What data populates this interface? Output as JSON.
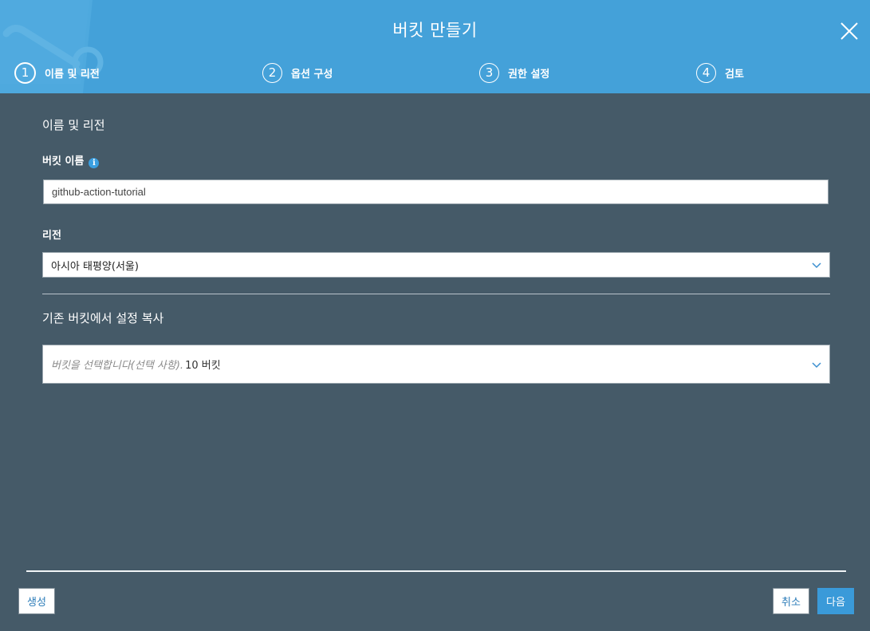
{
  "dialog": {
    "title": "버킷 만들기",
    "close_icon": "close-icon"
  },
  "steps": [
    {
      "number": "1",
      "label": "이름 및 리전",
      "active": true
    },
    {
      "number": "2",
      "label": "옵션 구성",
      "active": false
    },
    {
      "number": "3",
      "label": "권한 설정",
      "active": false
    },
    {
      "number": "4",
      "label": "검토",
      "active": false
    }
  ],
  "name_region": {
    "section_title": "이름 및 리전",
    "bucket_name_label": "버킷 이름",
    "bucket_name_value": "github-action-tutorial",
    "region_label": "리전",
    "region_value": "아시아 태평양(서울)"
  },
  "copy_settings": {
    "section_title": "기존 버킷에서 설정 복사",
    "placeholder": "버킷을 선택합니다(선택 사항).",
    "count_text": "10 버킷"
  },
  "footer": {
    "create_label": "생성",
    "cancel_label": "취소",
    "next_label": "다음"
  },
  "colors": {
    "header": "#44a1d9",
    "body": "#455a68",
    "primary_button": "#3a9ad9"
  }
}
